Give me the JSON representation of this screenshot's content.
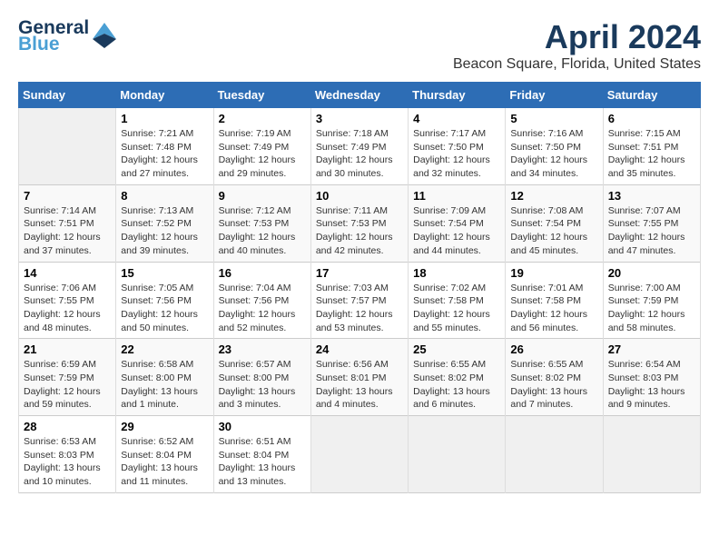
{
  "header": {
    "logo_line1": "General",
    "logo_line2": "Blue",
    "month_title": "April 2024",
    "location": "Beacon Square, Florida, United States"
  },
  "weekdays": [
    "Sunday",
    "Monday",
    "Tuesday",
    "Wednesday",
    "Thursday",
    "Friday",
    "Saturday"
  ],
  "weeks": [
    [
      {
        "day": "",
        "sunrise": "",
        "sunset": "",
        "daylight": ""
      },
      {
        "day": "1",
        "sunrise": "Sunrise: 7:21 AM",
        "sunset": "Sunset: 7:48 PM",
        "daylight": "Daylight: 12 hours and 27 minutes."
      },
      {
        "day": "2",
        "sunrise": "Sunrise: 7:19 AM",
        "sunset": "Sunset: 7:49 PM",
        "daylight": "Daylight: 12 hours and 29 minutes."
      },
      {
        "day": "3",
        "sunrise": "Sunrise: 7:18 AM",
        "sunset": "Sunset: 7:49 PM",
        "daylight": "Daylight: 12 hours and 30 minutes."
      },
      {
        "day": "4",
        "sunrise": "Sunrise: 7:17 AM",
        "sunset": "Sunset: 7:50 PM",
        "daylight": "Daylight: 12 hours and 32 minutes."
      },
      {
        "day": "5",
        "sunrise": "Sunrise: 7:16 AM",
        "sunset": "Sunset: 7:50 PM",
        "daylight": "Daylight: 12 hours and 34 minutes."
      },
      {
        "day": "6",
        "sunrise": "Sunrise: 7:15 AM",
        "sunset": "Sunset: 7:51 PM",
        "daylight": "Daylight: 12 hours and 35 minutes."
      }
    ],
    [
      {
        "day": "7",
        "sunrise": "Sunrise: 7:14 AM",
        "sunset": "Sunset: 7:51 PM",
        "daylight": "Daylight: 12 hours and 37 minutes."
      },
      {
        "day": "8",
        "sunrise": "Sunrise: 7:13 AM",
        "sunset": "Sunset: 7:52 PM",
        "daylight": "Daylight: 12 hours and 39 minutes."
      },
      {
        "day": "9",
        "sunrise": "Sunrise: 7:12 AM",
        "sunset": "Sunset: 7:53 PM",
        "daylight": "Daylight: 12 hours and 40 minutes."
      },
      {
        "day": "10",
        "sunrise": "Sunrise: 7:11 AM",
        "sunset": "Sunset: 7:53 PM",
        "daylight": "Daylight: 12 hours and 42 minutes."
      },
      {
        "day": "11",
        "sunrise": "Sunrise: 7:09 AM",
        "sunset": "Sunset: 7:54 PM",
        "daylight": "Daylight: 12 hours and 44 minutes."
      },
      {
        "day": "12",
        "sunrise": "Sunrise: 7:08 AM",
        "sunset": "Sunset: 7:54 PM",
        "daylight": "Daylight: 12 hours and 45 minutes."
      },
      {
        "day": "13",
        "sunrise": "Sunrise: 7:07 AM",
        "sunset": "Sunset: 7:55 PM",
        "daylight": "Daylight: 12 hours and 47 minutes."
      }
    ],
    [
      {
        "day": "14",
        "sunrise": "Sunrise: 7:06 AM",
        "sunset": "Sunset: 7:55 PM",
        "daylight": "Daylight: 12 hours and 48 minutes."
      },
      {
        "day": "15",
        "sunrise": "Sunrise: 7:05 AM",
        "sunset": "Sunset: 7:56 PM",
        "daylight": "Daylight: 12 hours and 50 minutes."
      },
      {
        "day": "16",
        "sunrise": "Sunrise: 7:04 AM",
        "sunset": "Sunset: 7:56 PM",
        "daylight": "Daylight: 12 hours and 52 minutes."
      },
      {
        "day": "17",
        "sunrise": "Sunrise: 7:03 AM",
        "sunset": "Sunset: 7:57 PM",
        "daylight": "Daylight: 12 hours and 53 minutes."
      },
      {
        "day": "18",
        "sunrise": "Sunrise: 7:02 AM",
        "sunset": "Sunset: 7:58 PM",
        "daylight": "Daylight: 12 hours and 55 minutes."
      },
      {
        "day": "19",
        "sunrise": "Sunrise: 7:01 AM",
        "sunset": "Sunset: 7:58 PM",
        "daylight": "Daylight: 12 hours and 56 minutes."
      },
      {
        "day": "20",
        "sunrise": "Sunrise: 7:00 AM",
        "sunset": "Sunset: 7:59 PM",
        "daylight": "Daylight: 12 hours and 58 minutes."
      }
    ],
    [
      {
        "day": "21",
        "sunrise": "Sunrise: 6:59 AM",
        "sunset": "Sunset: 7:59 PM",
        "daylight": "Daylight: 12 hours and 59 minutes."
      },
      {
        "day": "22",
        "sunrise": "Sunrise: 6:58 AM",
        "sunset": "Sunset: 8:00 PM",
        "daylight": "Daylight: 13 hours and 1 minute."
      },
      {
        "day": "23",
        "sunrise": "Sunrise: 6:57 AM",
        "sunset": "Sunset: 8:00 PM",
        "daylight": "Daylight: 13 hours and 3 minutes."
      },
      {
        "day": "24",
        "sunrise": "Sunrise: 6:56 AM",
        "sunset": "Sunset: 8:01 PM",
        "daylight": "Daylight: 13 hours and 4 minutes."
      },
      {
        "day": "25",
        "sunrise": "Sunrise: 6:55 AM",
        "sunset": "Sunset: 8:02 PM",
        "daylight": "Daylight: 13 hours and 6 minutes."
      },
      {
        "day": "26",
        "sunrise": "Sunrise: 6:55 AM",
        "sunset": "Sunset: 8:02 PM",
        "daylight": "Daylight: 13 hours and 7 minutes."
      },
      {
        "day": "27",
        "sunrise": "Sunrise: 6:54 AM",
        "sunset": "Sunset: 8:03 PM",
        "daylight": "Daylight: 13 hours and 9 minutes."
      }
    ],
    [
      {
        "day": "28",
        "sunrise": "Sunrise: 6:53 AM",
        "sunset": "Sunset: 8:03 PM",
        "daylight": "Daylight: 13 hours and 10 minutes."
      },
      {
        "day": "29",
        "sunrise": "Sunrise: 6:52 AM",
        "sunset": "Sunset: 8:04 PM",
        "daylight": "Daylight: 13 hours and 11 minutes."
      },
      {
        "day": "30",
        "sunrise": "Sunrise: 6:51 AM",
        "sunset": "Sunset: 8:04 PM",
        "daylight": "Daylight: 13 hours and 13 minutes."
      },
      {
        "day": "",
        "sunrise": "",
        "sunset": "",
        "daylight": ""
      },
      {
        "day": "",
        "sunrise": "",
        "sunset": "",
        "daylight": ""
      },
      {
        "day": "",
        "sunrise": "",
        "sunset": "",
        "daylight": ""
      },
      {
        "day": "",
        "sunrise": "",
        "sunset": "",
        "daylight": ""
      }
    ]
  ]
}
